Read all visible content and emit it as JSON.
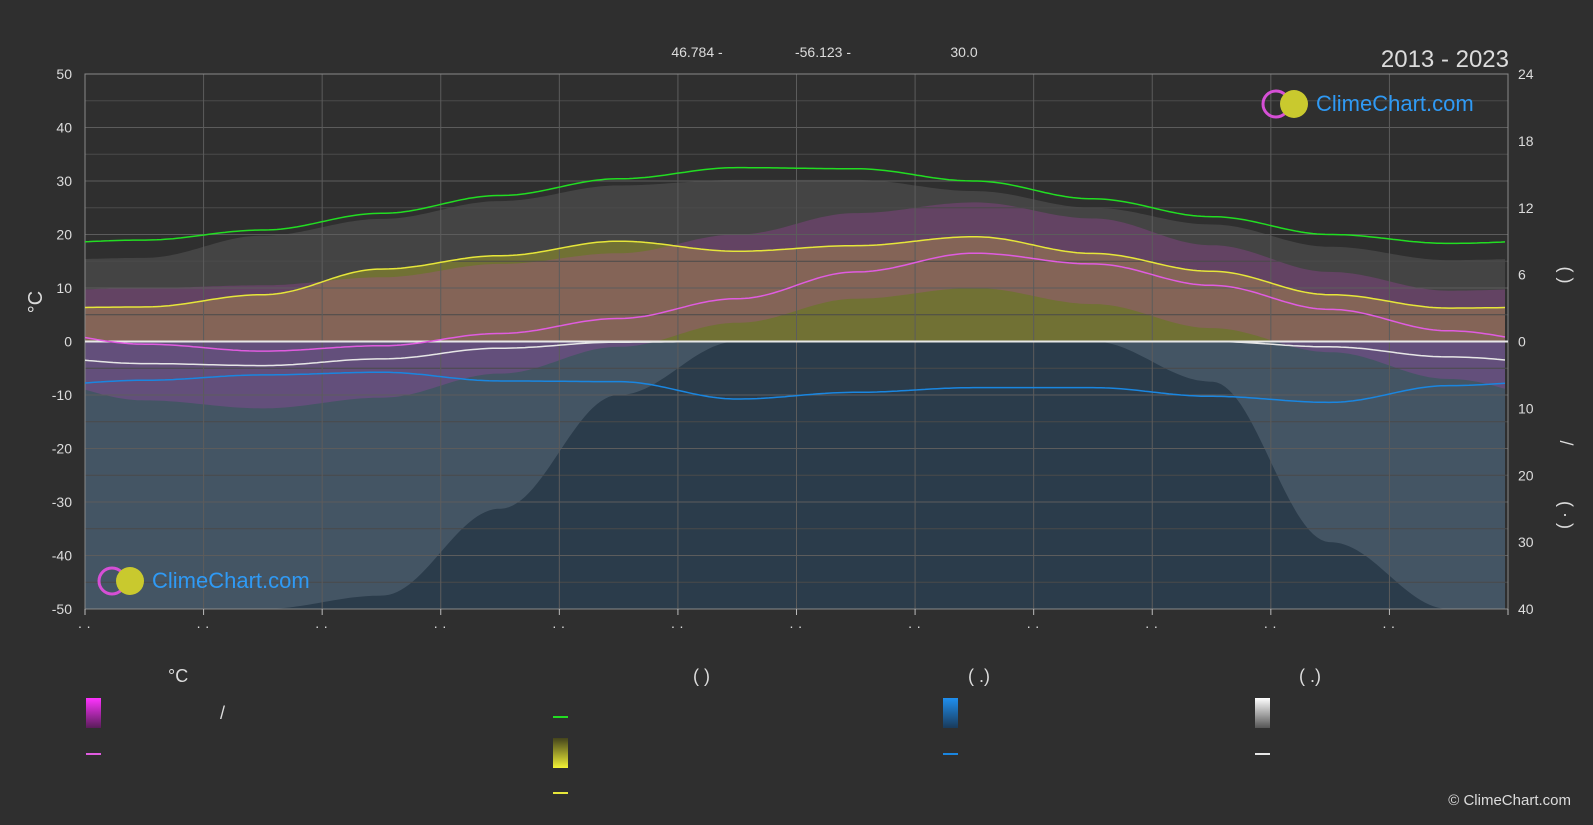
{
  "header": {
    "lat": "46.784 -",
    "lon": "-56.123 -",
    "elev": "30.0",
    "period": "2013 - 2023"
  },
  "axes": {
    "left_unit": "°C",
    "right_top_label": "(    )",
    "right_bottom_label_1": "/",
    "right_bottom_label_2": "(  ·  )"
  },
  "logo_text": "ClimeChart.com",
  "copyright": "© ClimeChart.com",
  "legend": {
    "col1_title": "°C",
    "col1_item1": "/",
    "col2_title": "(          )",
    "col3_title": "(    .)",
    "col4_title": "(    .)"
  },
  "colors": {
    "background": "#2f2f2f",
    "daylight": "#22dd22",
    "sunshine": "#e6e63a",
    "temperature": "#e05ce0",
    "precipitation": "#1a86e0",
    "snow": "#e6e6e6",
    "logo_text": "#2f9af5"
  },
  "chart_data": {
    "type": "line",
    "x_categories": [
      "· ·",
      "· ·",
      "· ·",
      "· ·",
      "· ·",
      "· ·",
      "· ·",
      "· ·",
      "· ·",
      "· ·",
      "· ·",
      "· ·"
    ],
    "left_axis": {
      "unit": "°C",
      "ylim": [
        -50,
        50
      ],
      "ticks": [
        50,
        40,
        30,
        20,
        10,
        0,
        -10,
        -20,
        -30,
        -40,
        -50
      ]
    },
    "right_axis_top": {
      "ylim": [
        0,
        24
      ],
      "ticks": [
        24,
        18,
        12,
        6,
        0
      ]
    },
    "right_axis_bottom": {
      "ylim": [
        0,
        40
      ],
      "ticks": [
        10,
        20,
        30,
        40
      ]
    },
    "grid": true,
    "series": [
      {
        "key": "daylight",
        "axis": "right_top",
        "values": [
          9.1,
          10.0,
          11.5,
          13.1,
          14.6,
          15.6,
          15.5,
          14.4,
          12.8,
          11.2,
          9.6,
          8.8
        ]
      },
      {
        "key": "sunshine",
        "axis": "right_top",
        "values": [
          3.1,
          4.2,
          6.5,
          7.7,
          9.0,
          8.1,
          8.6,
          9.4,
          7.9,
          6.3,
          4.2,
          3.0
        ]
      },
      {
        "key": "temperature_mean",
        "axis": "left",
        "values": [
          -0.5,
          -1.8,
          -0.8,
          1.5,
          4.3,
          8.0,
          13.0,
          16.5,
          14.5,
          10.5,
          6.0,
          2.0
        ]
      },
      {
        "key": "rain",
        "axis": "right_bottom",
        "values": [
          5.8,
          5.0,
          4.6,
          5.9,
          6.0,
          8.6,
          7.6,
          6.9,
          6.9,
          8.2,
          9.1,
          6.6
        ]
      },
      {
        "key": "snow",
        "axis": "right_bottom",
        "values": [
          3.3,
          3.6,
          2.6,
          1.0,
          0.1,
          0.0,
          0.0,
          0.0,
          0.0,
          0.0,
          0.8,
          2.3
        ]
      }
    ],
    "bands": {
      "temperature_max": [
        10.0,
        10.5,
        12.0,
        14.5,
        16.5,
        20.0,
        24.0,
        26.0,
        23.0,
        18.0,
        13.0,
        9.5
      ],
      "temperature_min": [
        -11.0,
        -12.5,
        -10.5,
        -6.0,
        -1.0,
        3.5,
        8.0,
        10.0,
        7.0,
        2.5,
        -2.0,
        -7.0
      ],
      "sunshine_max": [
        7.5,
        9.5,
        11.0,
        12.6,
        14.0,
        14.5,
        14.5,
        13.5,
        12.0,
        10.5,
        8.5,
        7.3
      ],
      "rain_max": [
        40,
        40,
        40,
        40,
        40,
        40,
        40,
        40,
        40,
        40,
        40,
        40
      ],
      "snow_max": [
        40,
        40,
        38,
        25,
        8,
        0,
        0,
        0,
        0,
        6,
        30,
        40
      ]
    }
  }
}
